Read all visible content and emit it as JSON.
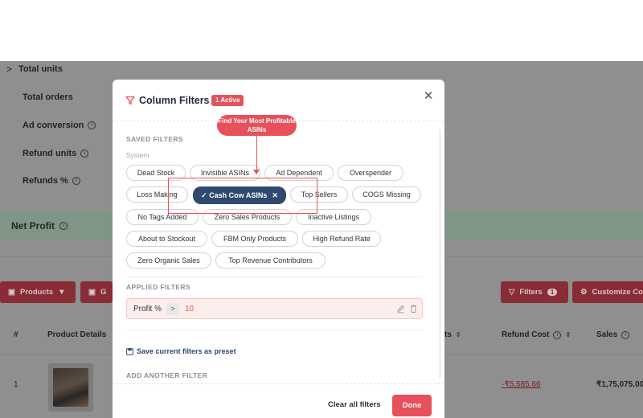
{
  "background": {
    "metrics": [
      {
        "label": "Total units",
        "has_chevron": true,
        "has_info": false
      },
      {
        "label": "Total orders",
        "has_chevron": false,
        "has_info": false
      },
      {
        "label": "Ad conversion",
        "has_chevron": false,
        "has_info": true
      },
      {
        "label": "Refund units",
        "has_chevron": false,
        "has_info": true
      },
      {
        "label": "Refunds %",
        "has_chevron": false,
        "has_info": true
      }
    ],
    "net_profit_label": "Net Profit",
    "toolbar": {
      "products_label": "Products",
      "second_label": "G",
      "filters_label": "Filters",
      "filters_count": "1",
      "customize_label": "Customize Co"
    },
    "table": {
      "headers": {
        "index": "#",
        "product_details": "Product Details",
        "units_partial": "ts",
        "refund_cost": "Refund Cost",
        "sales": "Sales"
      },
      "row": {
        "index": "1",
        "refund_cost": "-₹5,585.66",
        "sales": "₹1,75,075.00"
      }
    }
  },
  "modal": {
    "title": "Column Filters",
    "active_badge": "1 Active",
    "saved_filters_label": "SAVED FILTERS",
    "system_label": "System",
    "callout": "Find Your Most Profitable ASINs",
    "chips": [
      {
        "label": "Dead Stock",
        "active": false
      },
      {
        "label": "Invisible ASINs",
        "active": false
      },
      {
        "label": "Ad Dependent",
        "active": false
      },
      {
        "label": "Overspender",
        "active": false
      },
      {
        "label": "Loss Making",
        "active": false
      },
      {
        "label": "✓ Cash Cow ASINs",
        "active": true
      },
      {
        "label": "Top Sellers",
        "active": false
      },
      {
        "label": "COGS Missing",
        "active": false
      },
      {
        "label": "No Tags Added",
        "active": false
      },
      {
        "label": "Zero Sales Products",
        "active": false
      },
      {
        "label": "Inactive Listings",
        "active": false
      },
      {
        "label": "About to Stockout",
        "active": false
      },
      {
        "label": "FBM Only Products",
        "active": false
      },
      {
        "label": "High Refund Rate",
        "active": false
      },
      {
        "label": "Zero Organic Sales",
        "active": false
      },
      {
        "label": "Top Revenue Contributors",
        "active": false
      }
    ],
    "applied_filters_label": "APPLIED FILTERS",
    "applied_filter": {
      "field": "Profit %",
      "operator": ">",
      "value": "10"
    },
    "save_preset_label": "Save current filters as preset",
    "add_filter_label": "ADD ANOTHER FILTER",
    "clear_all_label": "Clear all filters",
    "done_label": "Done"
  },
  "colors": {
    "accent": "#e8505b",
    "active_chip": "#2f4a6e",
    "overlay": "#8f8f8f"
  }
}
